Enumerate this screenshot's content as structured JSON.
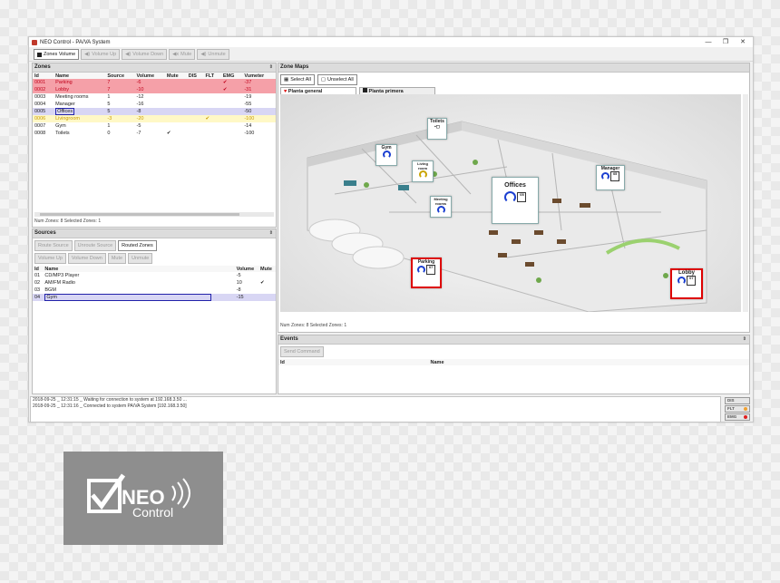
{
  "window": {
    "title": "NEO Control - PA/VA System",
    "controls": [
      "—",
      "❐",
      "✕"
    ]
  },
  "toolbar": {
    "zones_volume": "Zones Volume",
    "volume_up": "Volume Up",
    "volume_down": "Volume Down",
    "mute": "Mute",
    "unmute": "Unmute"
  },
  "zones": {
    "title": "Zones",
    "columns": [
      "Id",
      "Name",
      "Source",
      "Volume",
      "Mute",
      "DIS",
      "FLT",
      "EMG",
      "Vumeter"
    ],
    "rows": [
      {
        "id": "0001",
        "name": "Parking",
        "source": "7",
        "volume": "-6",
        "mute": "",
        "dis": "",
        "flt": "",
        "emg": "✔",
        "vu": "-37",
        "style": "red"
      },
      {
        "id": "0002",
        "name": "Lobby",
        "source": "7",
        "volume": "-10",
        "mute": "",
        "dis": "",
        "flt": "",
        "emg": "✔",
        "vu": "-31",
        "style": "red"
      },
      {
        "id": "0003",
        "name": "Meeting rooms",
        "source": "1",
        "volume": "-12",
        "mute": "",
        "dis": "",
        "flt": "",
        "emg": "",
        "vu": "-19",
        "style": ""
      },
      {
        "id": "0004",
        "name": "Manager",
        "source": "5",
        "volume": "-16",
        "mute": "",
        "dis": "",
        "flt": "",
        "emg": "",
        "vu": "-55",
        "style": ""
      },
      {
        "id": "0005",
        "name": "Offices",
        "source": "5",
        "volume": "-8",
        "mute": "",
        "dis": "",
        "flt": "",
        "emg": "",
        "vu": "-50",
        "style": "sel"
      },
      {
        "id": "0006",
        "name": "Livingroom",
        "source": "-3",
        "volume": "-20",
        "mute": "",
        "dis": "",
        "flt": "✔",
        "emg": "",
        "vu": "-100",
        "style": "yel"
      },
      {
        "id": "0007",
        "name": "Gym",
        "source": "1",
        "volume": "-5",
        "mute": "",
        "dis": "",
        "flt": "",
        "emg": "",
        "vu": "-14",
        "style": ""
      },
      {
        "id": "0008",
        "name": "Toilets",
        "source": "0",
        "volume": "-7",
        "mute": "✔",
        "dis": "",
        "flt": "",
        "emg": "",
        "vu": "-100",
        "style": ""
      }
    ],
    "status": "Num Zones: 8     Selected Zones: 1"
  },
  "sources": {
    "title": "Sources",
    "route_source": "Route Source",
    "unroute_source": "Unroute Source",
    "routed_zones": "Routed Zones",
    "volume_up": "Volume Up",
    "volume_down": "Volume Down",
    "mute": "Mute",
    "unmute": "Unmute",
    "columns": [
      "Id",
      "Name",
      "Volume",
      "Mute"
    ],
    "rows": [
      {
        "id": "01",
        "name": "CD/MP3 Player",
        "volume": "-5",
        "mute": "",
        "style": ""
      },
      {
        "id": "02",
        "name": "AM/FM Radio",
        "volume": "10",
        "mute": "✔",
        "style": ""
      },
      {
        "id": "03",
        "name": "BGM",
        "volume": "-8",
        "mute": "",
        "style": ""
      },
      {
        "id": "04",
        "name": "Gym",
        "volume": "-15",
        "mute": "",
        "style": "sel"
      }
    ]
  },
  "zone_maps": {
    "title": "Zone Maps",
    "select_all": "Select All",
    "unselect_all": "Unselect All",
    "tabs": [
      "Planta general",
      "Planta primera"
    ],
    "status": "Num Zones: 8     Selected Zones: 1",
    "cards": [
      {
        "label": "Toilets",
        "vol": ""
      },
      {
        "label": "Gym",
        "vol": ""
      },
      {
        "label": "Living room",
        "vol": ""
      },
      {
        "label": "Meeting rooms",
        "vol": ""
      },
      {
        "label": "Offices",
        "vol": "05"
      },
      {
        "label": "Manager",
        "vol": "05"
      },
      {
        "label": "Parking",
        "vol": "07"
      },
      {
        "label": "Lobby",
        "vol": "07"
      }
    ]
  },
  "events": {
    "title": "Events",
    "send_command": "Send Command",
    "columns": [
      "Id",
      "Name"
    ]
  },
  "log": [
    "2018-09-25 _ 12:31:15 _ Waiting for connection to system at 192.168.3.50 ...",
    "2018-09-25 _ 12:31:16 _ Connected to system PA/VA System [192.168.3.50]"
  ],
  "indicators": [
    {
      "label": "DIS",
      "color": ""
    },
    {
      "label": "FLT",
      "color": "#f0a030"
    },
    {
      "label": "EMG",
      "color": "#e02020"
    }
  ],
  "logo": {
    "text_neo": "NEO",
    "text_control": "Control"
  }
}
